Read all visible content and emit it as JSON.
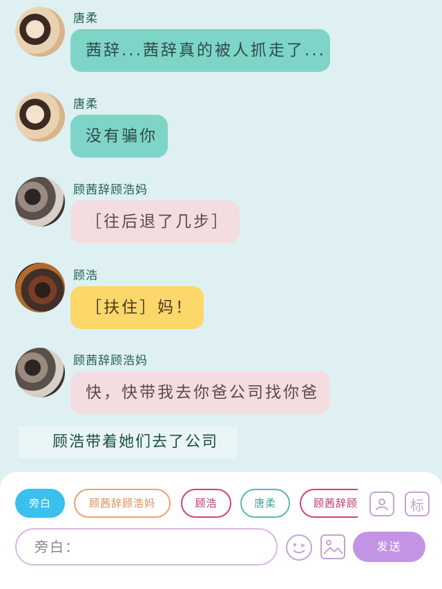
{
  "messages": [
    {
      "name": "唐柔",
      "text": "茜辞...茜辞真的被人抓走了...",
      "style": "teal",
      "avatar": "avatar-tangrou"
    },
    {
      "name": "唐柔",
      "text": "没有骗你",
      "style": "teal",
      "avatar": "avatar-tangrou"
    },
    {
      "name": "顾茜辞顾浩妈",
      "text": "［往后退了几步］",
      "style": "pink",
      "avatar": "avatar-mother"
    },
    {
      "name": "顾浩",
      "text": "［扶住］妈！",
      "style": "yellow",
      "avatar": "avatar-guhao"
    },
    {
      "name": "顾茜辞顾浩妈",
      "text": "快，快带我去你爸公司找你爸",
      "style": "pink",
      "avatar": "avatar-mother"
    }
  ],
  "narration": "顾浩带着她们去了公司",
  "roles": [
    {
      "label": "旁白",
      "active": true,
      "color": "#39c0ec"
    },
    {
      "label": "顾茜辞顾浩妈",
      "active": false,
      "color": "#f0a06a"
    },
    {
      "label": "顾浩",
      "active": false,
      "color": "#d0407a"
    },
    {
      "label": "唐柔",
      "active": false,
      "color": "#5bb7b0"
    },
    {
      "label": "顾茜辞顾浩妈",
      "active": false,
      "color": "#d0407a"
    }
  ],
  "toolbar": {
    "contact_icon": "contact-card-icon",
    "tag_icon_label": "标",
    "input_placeholder": "旁白：",
    "send_label": "发送"
  },
  "colors": {
    "background": "#dff0f2",
    "teal_bubble": "#7fd4c8",
    "pink_bubble": "#f3dde0",
    "yellow_bubble": "#fcd76a",
    "accent": "#c394e6"
  }
}
